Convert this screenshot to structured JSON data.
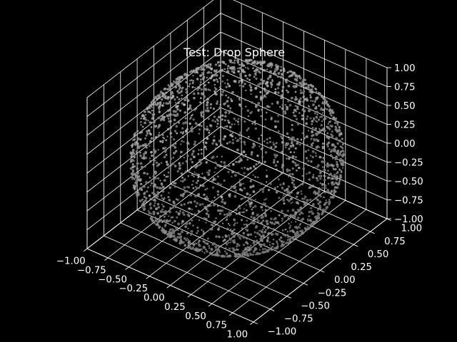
{
  "chart_data": {
    "type": "scatter",
    "projection": "3d",
    "title": "Test: Drop Sphere",
    "xlabel": "",
    "ylabel": "",
    "zlabel": "",
    "xlim": [
      -1.0,
      1.0
    ],
    "ylim": [
      -1.0,
      1.0
    ],
    "zlim": [
      -1.0,
      1.0
    ],
    "x_ticks": [
      "−1.00",
      "−0.75",
      "−0.50",
      "−0.25",
      "0.00",
      "0.25",
      "0.50",
      "0.75",
      "1.00"
    ],
    "y_ticks": [
      "−1.00",
      "−0.75",
      "−0.50",
      "−0.25",
      "0.00",
      "0.25",
      "0.50",
      "0.75",
      "1.00"
    ],
    "z_ticks": [
      "−1.00",
      "−0.75",
      "−0.50",
      "−0.25",
      "0.00",
      "0.25",
      "0.50",
      "0.75",
      "1.00"
    ],
    "grid": true,
    "background": "#000000",
    "foreground": "#ffffff",
    "series": [
      {
        "shape": "sphere",
        "center": [
          0.0,
          0.0,
          0.0
        ],
        "radius": 1.0,
        "marker_color": "#bfbfbf"
      }
    ]
  }
}
